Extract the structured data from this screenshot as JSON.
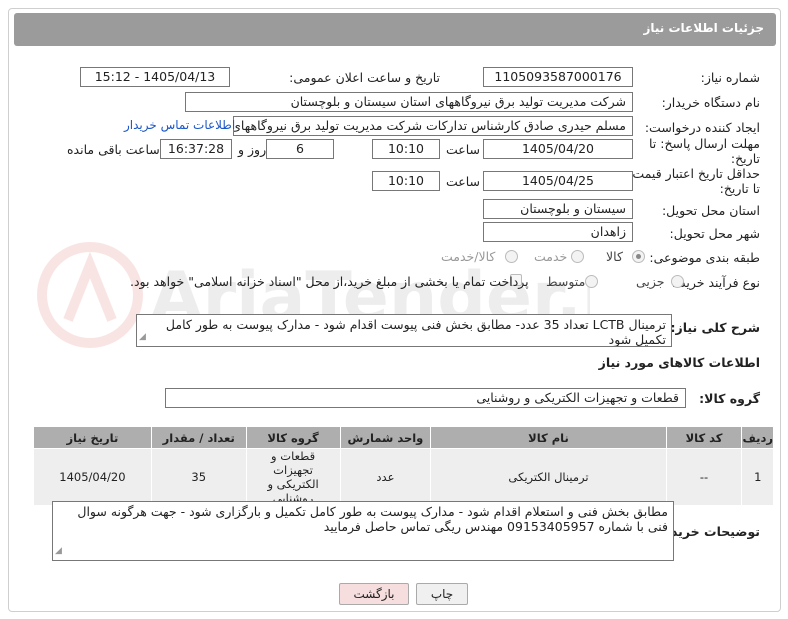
{
  "header": {
    "title": "جزئیات اطلاعات نیاز"
  },
  "form": {
    "need_number_label": "شماره نیاز:",
    "need_number": "1105093587000176",
    "announce_label": "تاریخ و ساعت اعلان عمومی:",
    "announce_value": "1405/04/13 - 15:12",
    "buyer_org_label": "نام دستگاه خریدار:",
    "buyer_org": "شرکت مدیریت تولید برق نیروگاههای استان سیستان و بلوچستان",
    "requester_label": "ایجاد کننده درخواست:",
    "requester": "مسلم حیدری صادق کارشناس تدارکات شرکت مدیریت تولید برق نیروگاههای اس",
    "contact_link": "اطلاعات تماس خریدار",
    "reply_deadline_label": "مهلت ارسال پاسخ: تا تاریخ:",
    "reply_date": "1405/04/20",
    "time_label": "ساعت",
    "reply_time": "10:10",
    "days_value": "6",
    "days_label": "روز و",
    "remaining_time": "16:37:28",
    "remaining_label": "ساعت باقی مانده",
    "price_validity_label": "حداقل تاریخ اعتبار قیمت: تا تاریخ:",
    "validity_date": "1405/04/25",
    "validity_time": "10:10",
    "province_label": "استان محل تحویل:",
    "province": "سیستان و بلوچستان",
    "city_label": "شهر محل تحویل:",
    "city": "زاهدان",
    "category_label": "طبقه بندی موضوعی:",
    "category_options": [
      "کالا",
      "خدمت",
      "کالا/خدمت"
    ],
    "purchase_type_label": "نوع فرآیند خرید :",
    "purchase_options": [
      "جزیی",
      "متوسط"
    ],
    "payment_note": "پرداخت تمام یا بخشی از مبلغ خرید،از محل \"اسناد خزانه اسلامی\" خواهد بود.",
    "description_label": "شرح کلی نیاز:",
    "description": "ترمینال  LCTB   تعداد   35  عدد-   مطابق بخش  فنی پیوست اقدام شود - مدارک پیوست به طور کامل تکمیل شود"
  },
  "goods": {
    "section_title": "اطلاعات کالاهای مورد نیاز",
    "group_label": "گروه کالا:",
    "group_value": "قطعات و تجهیزات الکتریکی و روشنایی",
    "columns": [
      "ردیف",
      "کد کالا",
      "نام کالا",
      "واحد شمارش",
      "گروه کالا",
      "تعداد / مقدار",
      "تاریخ نیاز"
    ],
    "rows": [
      {
        "row": "1",
        "code": "--",
        "name": "ترمینال الکتریکی",
        "unit": "عدد",
        "group": "قطعات و تجهیزات الکتریکی و روشنایی",
        "qty": "35",
        "date": "1405/04/20"
      }
    ]
  },
  "buyer_notes": {
    "label": "توضیحات خریدار:",
    "text": "مطابق بخش فنی و استعلام اقدام شود -  مدارک پیوست به طور کامل تکمیل و بارگزاری شود - جهت هرگونه سوال فنی با شماره 09153405957 مهندس ریگی تماس حاصل فرمایید"
  },
  "buttons": {
    "print": "چاپ",
    "back": "بازگشت"
  },
  "watermark": {
    "text": "AriaTender.net"
  },
  "colors": {
    "header_bg": "#9b9b9b",
    "table_header_bg": "#aeaeae",
    "row_bg": "#eeeeee",
    "link": "#1a56c8",
    "back_button_bg": "#f6dede"
  }
}
